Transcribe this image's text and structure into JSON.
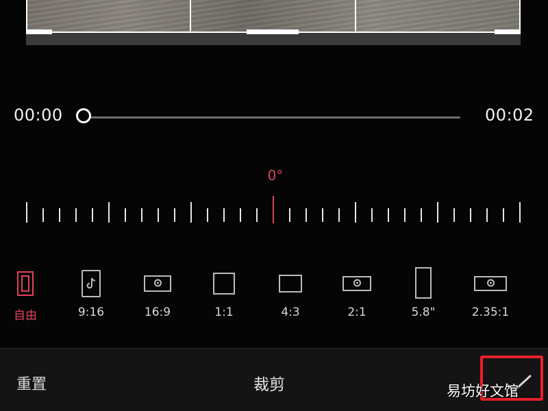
{
  "timeline": {
    "start_time": "00:00",
    "end_time": "00:02",
    "progress": 0
  },
  "rotation": {
    "angle_label": "0°",
    "accent_color": "#e0435c"
  },
  "ratios": [
    {
      "label": "自由",
      "icon": "free-frame-icon",
      "active": true
    },
    {
      "label": "9:16",
      "icon": "tiktok-icon",
      "active": false
    },
    {
      "label": "16:9",
      "icon": "widescreen-icon",
      "active": false
    },
    {
      "label": "1:1",
      "icon": "square-icon",
      "active": false
    },
    {
      "label": "4:3",
      "icon": "landscape-icon",
      "active": false
    },
    {
      "label": "2:1",
      "icon": "wide-frame-icon",
      "active": false
    },
    {
      "label": "5.8\"",
      "icon": "tall-frame-icon",
      "active": false
    },
    {
      "label": "2.35:1",
      "icon": "cinema-frame-icon",
      "active": false
    }
  ],
  "bottom_bar": {
    "reset_label": "重置",
    "title": "裁剪",
    "confirm_icon": "checkmark-icon"
  },
  "watermark": "易坊好文馆",
  "colors": {
    "accent": "#e0435c",
    "highlight": "#e8202a",
    "background": "#050505"
  }
}
